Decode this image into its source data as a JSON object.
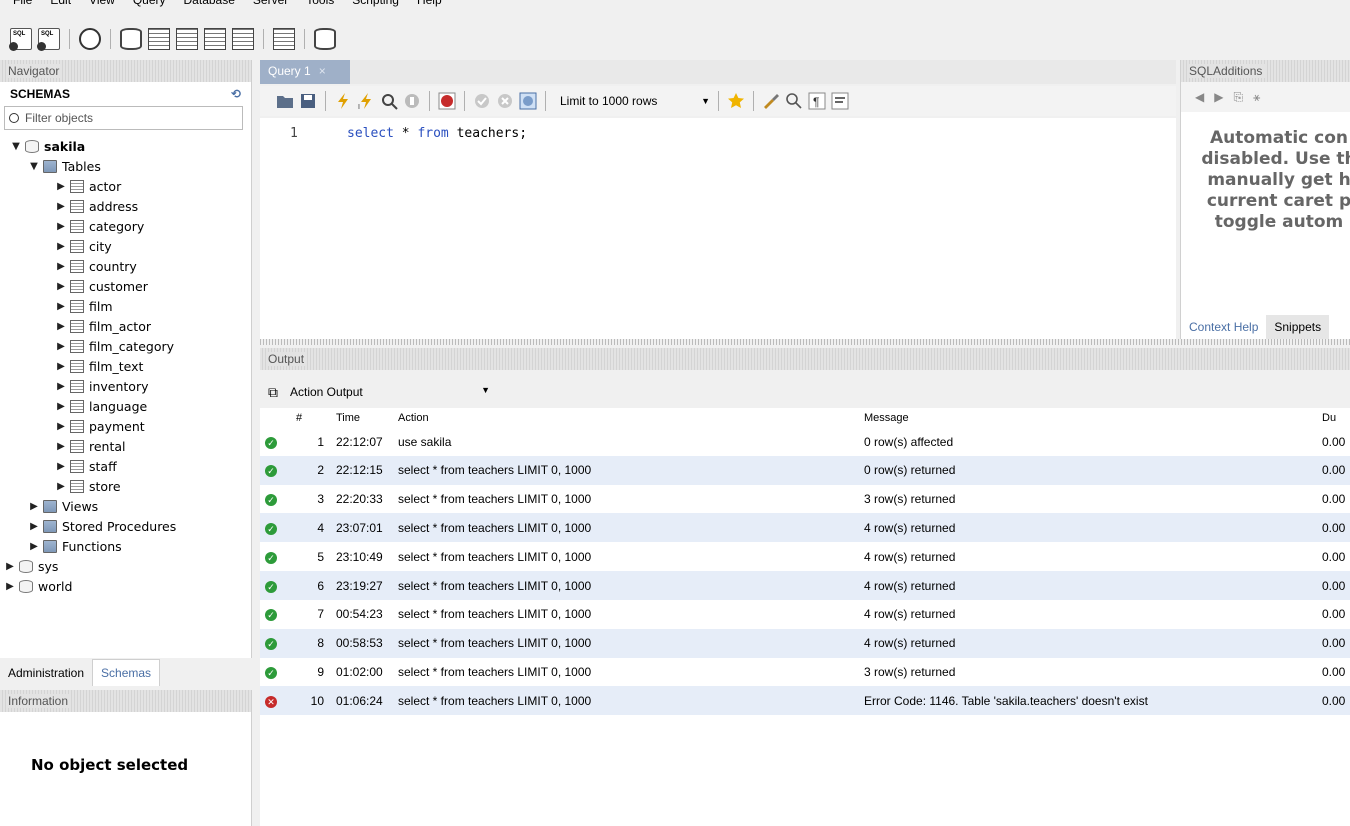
{
  "menu": [
    "File",
    "Edit",
    "View",
    "Query",
    "Database",
    "Server",
    "Tools",
    "Scripting",
    "Help"
  ],
  "navigator": {
    "title": "Navigator",
    "schemas_label": "SCHEMAS",
    "filter_placeholder": "Filter objects",
    "schema_name": "sakila",
    "tables_label": "Tables",
    "tables": [
      "actor",
      "address",
      "category",
      "city",
      "country",
      "customer",
      "film",
      "film_actor",
      "film_category",
      "film_text",
      "inventory",
      "language",
      "payment",
      "rental",
      "staff",
      "store"
    ],
    "views_label": "Views",
    "procs_label": "Stored Procedures",
    "funcs_label": "Functions",
    "other_schemas": [
      "sys",
      "world"
    ],
    "tabs": [
      "Administration",
      "Schemas"
    ]
  },
  "information": {
    "title": "Information",
    "no_object": "No object selected"
  },
  "query": {
    "tab_label": "Query 1",
    "limit_label": "Limit to 1000 rows",
    "line_number": "1",
    "code_kw1": "select",
    "code_mid": " * ",
    "code_kw2": "from",
    "code_rest": " teachers;"
  },
  "sql_additions": {
    "title": "SQLAdditions",
    "help_text": [
      "Automatic con",
      "disabled. Use th",
      "manually get h",
      "current caret p",
      "toggle autom"
    ],
    "tabs": [
      "Context Help",
      "Snippets"
    ]
  },
  "output": {
    "title": "Output",
    "selector": "Action Output",
    "columns": [
      "#",
      "Time",
      "Action",
      "Message",
      "Du"
    ],
    "rows": [
      {
        "status": "ok",
        "num": "1",
        "time": "22:12:07",
        "action": "use sakila",
        "message": "0 row(s) affected",
        "duration": "0.00"
      },
      {
        "status": "ok",
        "num": "2",
        "time": "22:12:15",
        "action": "select * from teachers LIMIT 0, 1000",
        "message": "0 row(s) returned",
        "duration": "0.00"
      },
      {
        "status": "ok",
        "num": "3",
        "time": "22:20:33",
        "action": "select * from teachers LIMIT 0, 1000",
        "message": "3 row(s) returned",
        "duration": "0.00"
      },
      {
        "status": "ok",
        "num": "4",
        "time": "23:07:01",
        "action": "select * from teachers LIMIT 0, 1000",
        "message": "4 row(s) returned",
        "duration": "0.00"
      },
      {
        "status": "ok",
        "num": "5",
        "time": "23:10:49",
        "action": "select * from teachers LIMIT 0, 1000",
        "message": "4 row(s) returned",
        "duration": "0.00"
      },
      {
        "status": "ok",
        "num": "6",
        "time": "23:19:27",
        "action": "select * from teachers LIMIT 0, 1000",
        "message": "4 row(s) returned",
        "duration": "0.00"
      },
      {
        "status": "ok",
        "num": "7",
        "time": "00:54:23",
        "action": "select * from teachers LIMIT 0, 1000",
        "message": "4 row(s) returned",
        "duration": "0.00"
      },
      {
        "status": "ok",
        "num": "8",
        "time": "00:58:53",
        "action": "select * from teachers LIMIT 0, 1000",
        "message": "4 row(s) returned",
        "duration": "0.00"
      },
      {
        "status": "ok",
        "num": "9",
        "time": "01:02:00",
        "action": "select * from teachers LIMIT 0, 1000",
        "message": "3 row(s) returned",
        "duration": "0.00"
      },
      {
        "status": "error",
        "num": "10",
        "time": "01:06:24",
        "action": "select * from teachers LIMIT 0, 1000",
        "message": "Error Code: 1146. Table 'sakila.teachers' doesn't exist",
        "duration": "0.00"
      }
    ]
  },
  "colors": {
    "accent": "#4a6fa5",
    "tab_active": "#9fb0c8",
    "row_alt": "#e6edf8",
    "ok": "#2d9b3a",
    "error": "#c62b2b"
  }
}
